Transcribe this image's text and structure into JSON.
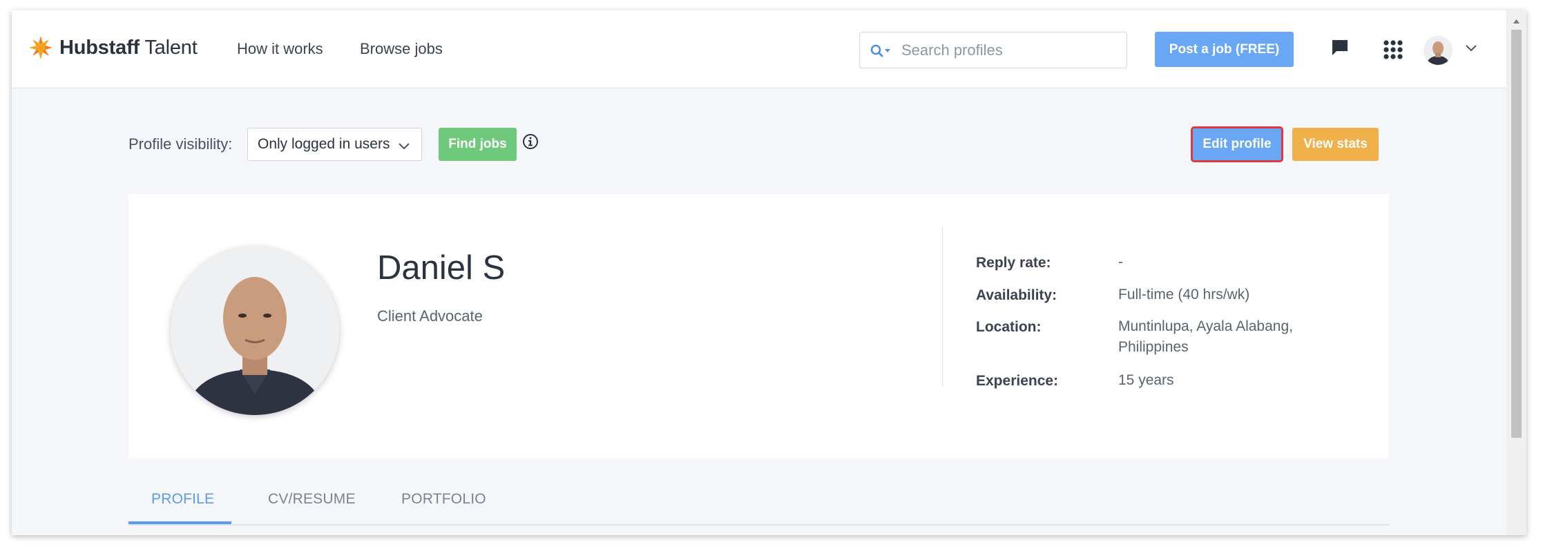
{
  "header": {
    "brand_bold": "Hubstaff",
    "brand_light": "Talent",
    "nav": [
      {
        "label": "How it works"
      },
      {
        "label": "Browse jobs"
      }
    ],
    "search_placeholder": "Search profiles",
    "post_job_label": "Post a job (FREE)",
    "icons": [
      "search-icon",
      "chat-icon",
      "apps-grid-icon",
      "avatar",
      "chevron-down-icon"
    ]
  },
  "toolbar": {
    "visibility_label": "Profile visibility:",
    "visibility_value": "Only logged in users",
    "find_jobs_label": "Find jobs",
    "edit_profile_label": "Edit profile",
    "view_stats_label": "View stats"
  },
  "profile": {
    "name": "Daniel S",
    "title": "Client Advocate",
    "stats": [
      {
        "label": "Reply rate:",
        "value": "-"
      },
      {
        "label": "Availability:",
        "value": "Full-time (40 hrs/wk)"
      },
      {
        "label": "Location:",
        "value_line1": "Muntinlupa, Ayala Alabang,",
        "value_line2": "Philippines"
      },
      {
        "label": "Experience:",
        "value": "15 years"
      }
    ]
  },
  "tabs": [
    {
      "label": "PROFILE",
      "active": true
    },
    {
      "label": "CV/RESUME",
      "active": false
    },
    {
      "label": "PORTFOLIO",
      "active": false
    }
  ],
  "colors": {
    "accent_blue": "#69a7f4",
    "find_jobs_green": "#6ec97a",
    "view_stats_orange": "#f0b04a",
    "highlight_red": "#e0383e",
    "logo_orange": "#f47b20"
  }
}
